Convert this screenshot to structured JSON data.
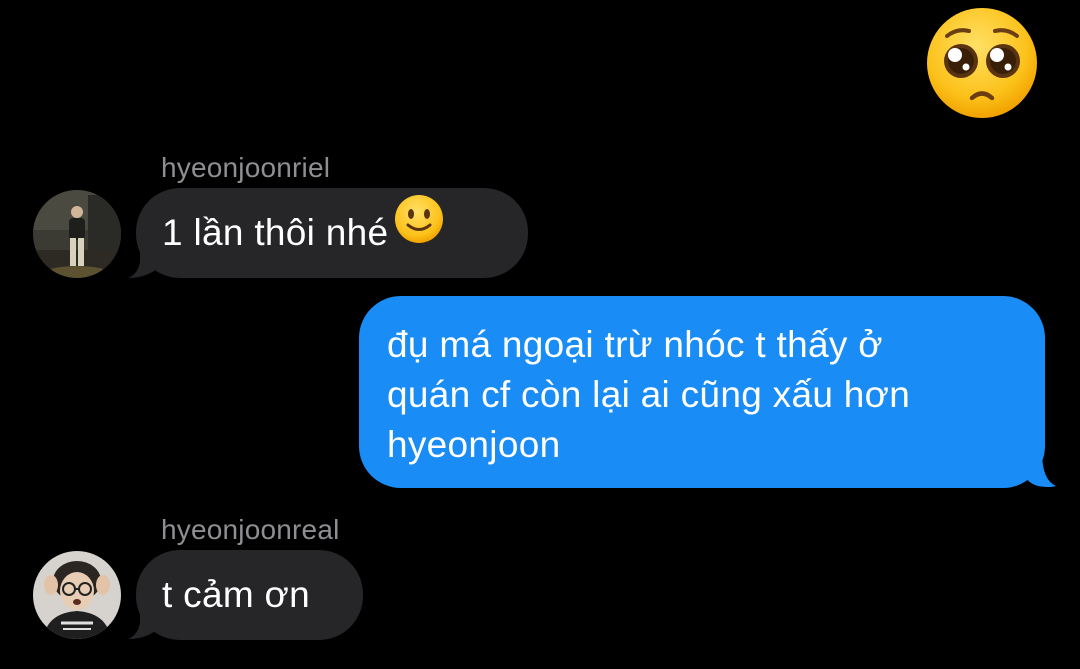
{
  "reaction": {
    "icon": "pleading-face-emoji"
  },
  "messages": [
    {
      "sender": "hyeonjoonriel",
      "text": "1 lần thôi nhé",
      "trailing_emoji": "slightly-smiling-face-emoji",
      "direction": "incoming"
    },
    {
      "sender": "",
      "text": "đụ má ngoại trừ nhóc t thấy ở\nquán cf còn lại ai cũng xấu hơn\nhyeonjoon",
      "direction": "outgoing"
    },
    {
      "sender": "hyeonjoonreal",
      "text": "t cảm ơn",
      "direction": "incoming"
    }
  ],
  "colors": {
    "background": "#000000",
    "incoming_bubble": "#262629",
    "outgoing_bubble": "#1a8cf5",
    "sender_name": "#8e8e93",
    "text": "#ffffff"
  }
}
